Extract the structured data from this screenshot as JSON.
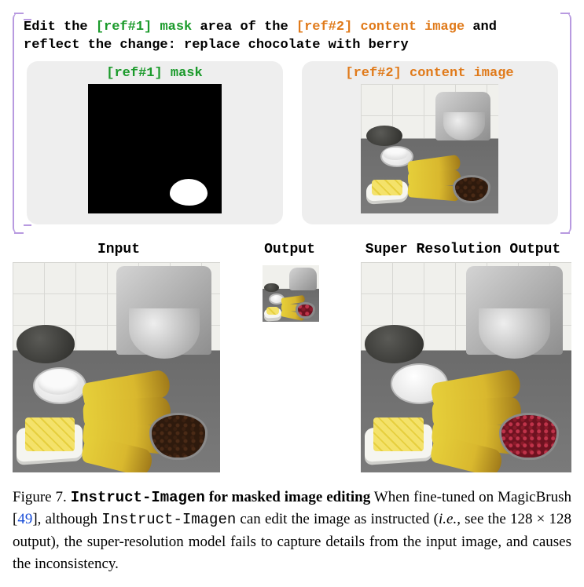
{
  "prompt": {
    "pre": "Edit the ",
    "ref1": "[ref#1] mask",
    "mid1": " area of the ",
    "ref2": "[ref#2] content image",
    "mid2": " and reflect the change: replace chocolate with berry"
  },
  "refs": {
    "mask_title": "[ref#1] mask",
    "content_title": "[ref#2] content image"
  },
  "columns": {
    "input": "Input",
    "output": "Output",
    "super": "Super Resolution Output"
  },
  "caption": {
    "fig_num": "Figure 7.",
    "title_mono": "Instruct-Imagen",
    "title_rest": " for masked image editing",
    "body1": " When fine-tuned on MagicBrush [",
    "cite": "49",
    "body2": "], although ",
    "mono2": "Instruct-Imagen",
    "body3": " can edit the image as instructed (",
    "ie": "i.e.",
    "body4": ", see the ",
    "dim": "128 × 128",
    "body5": " output), the super-resolution model fails to capture details from the input image, and causes the inconsistency."
  }
}
